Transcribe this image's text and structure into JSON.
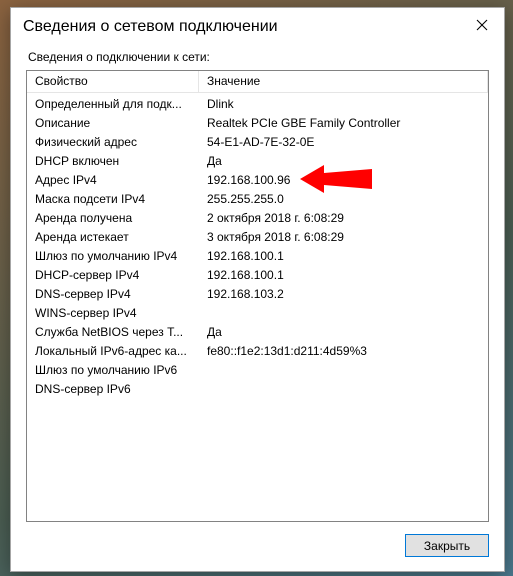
{
  "dialog": {
    "title": "Сведения о сетевом подключении",
    "subtitle": "Сведения о подключении к сети:",
    "close_button": "Закрыть"
  },
  "table": {
    "header": {
      "property": "Свойство",
      "value": "Значение"
    },
    "rows": [
      {
        "property": "Определенный для подк...",
        "value": "Dlink"
      },
      {
        "property": "Описание",
        "value": "Realtek PCIe GBE Family Controller"
      },
      {
        "property": "Физический адрес",
        "value": "54-E1-AD-7E-32-0E"
      },
      {
        "property": "DHCP включен",
        "value": "Да"
      },
      {
        "property": "Адрес IPv4",
        "value": "192.168.100.96"
      },
      {
        "property": "Маска подсети IPv4",
        "value": "255.255.255.0"
      },
      {
        "property": "Аренда получена",
        "value": "2 октября 2018 г. 6:08:29"
      },
      {
        "property": "Аренда истекает",
        "value": "3 октября 2018 г. 6:08:29"
      },
      {
        "property": "Шлюз по умолчанию IPv4",
        "value": "192.168.100.1"
      },
      {
        "property": "DHCP-сервер IPv4",
        "value": "192.168.100.1"
      },
      {
        "property": "DNS-сервер IPv4",
        "value": "192.168.103.2"
      },
      {
        "property": "WINS-сервер IPv4",
        "value": ""
      },
      {
        "property": "Служба NetBIOS через T...",
        "value": "Да"
      },
      {
        "property": "Локальный IPv6-адрес ка...",
        "value": "fe80::f1e2:13d1:d211:4d59%3"
      },
      {
        "property": "Шлюз по умолчанию IPv6",
        "value": ""
      },
      {
        "property": "DNS-сервер IPv6",
        "value": ""
      }
    ]
  },
  "annotation": {
    "arrow_color": "#ff0000",
    "arrow_row_index": 4
  }
}
